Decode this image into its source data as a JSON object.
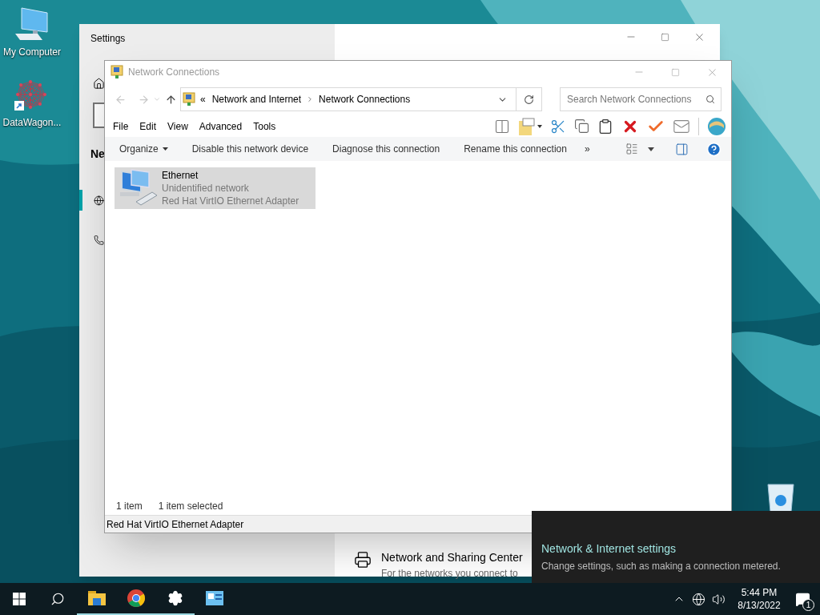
{
  "desktop": {
    "icons": [
      {
        "label": "My Computer",
        "kind": "computer"
      },
      {
        "label": "DataWagon...",
        "kind": "app"
      }
    ]
  },
  "settings_window": {
    "title": "Settings",
    "nav_heading": "Ne",
    "nav_items": [
      {
        "kind": "globe",
        "selected": true
      },
      {
        "kind": "dialup",
        "selected": false
      }
    ],
    "link": {
      "title": "Network and Sharing Center",
      "subtitle": "For the networks you connect to"
    }
  },
  "explorer": {
    "title": "Network Connections",
    "breadcrumb_prefix": "«",
    "breadcrumb": [
      "Network and Internet",
      "Network Connections"
    ],
    "search": {
      "placeholder": "Search Network Connections"
    },
    "menu": [
      "File",
      "Edit",
      "View",
      "Advanced",
      "Tools"
    ],
    "commands": [
      {
        "label": "Organize",
        "kind": "dropdown"
      },
      {
        "label": "Disable this network device",
        "kind": "plain"
      },
      {
        "label": "Diagnose this connection",
        "kind": "plain"
      },
      {
        "label": "Rename this connection",
        "kind": "plain"
      }
    ],
    "overflow": "»",
    "items": [
      {
        "name": "Ethernet",
        "status": "Unidentified network",
        "device": "Red Hat VirtIO Ethernet Adapter",
        "selected": true
      }
    ],
    "status": {
      "count": "1 item",
      "selection": "1 item selected"
    },
    "details": "Red Hat VirtIO Ethernet Adapter"
  },
  "flyout": {
    "title": "Network & Internet settings",
    "subtitle": "Change settings, such as making a connection metered."
  },
  "taskbar": {
    "apps": [
      {
        "kind": "folder",
        "selected": true
      },
      {
        "kind": "browser",
        "selected": true
      },
      {
        "kind": "gear",
        "selected": true
      },
      {
        "kind": "control",
        "selected": false
      }
    ],
    "time": "5:44 PM",
    "date": "8/13/2022",
    "notifications": "1"
  }
}
